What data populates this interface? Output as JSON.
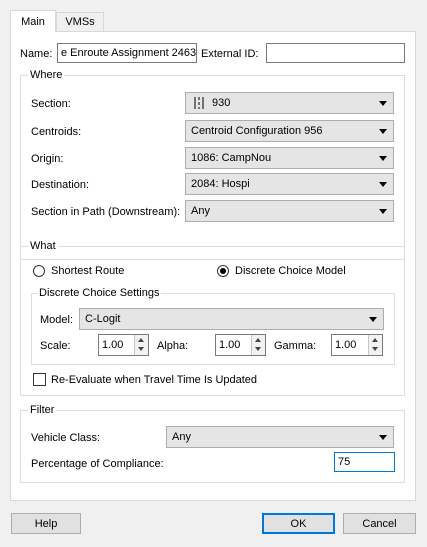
{
  "tabs": [
    {
      "label": "Main"
    },
    {
      "label": "VMSs"
    }
  ],
  "name": {
    "label": "Name:",
    "value": "e Enroute Assignment 2463"
  },
  "external_id": {
    "label": "External ID:",
    "value": ""
  },
  "where": {
    "title": "Where",
    "section": {
      "label": "Section:",
      "value": "930",
      "icon": "road-section-icon"
    },
    "centroids": {
      "label": "Centroids:",
      "value": "Centroid Configuration 956"
    },
    "origin": {
      "label": "Origin:",
      "value": "1086: CampNou"
    },
    "destination": {
      "label": "Destination:",
      "value": "2084: Hospi"
    },
    "section_in_path": {
      "label": "Section in Path (Downstream):",
      "value": "Any"
    }
  },
  "what": {
    "title": "What",
    "shortest_route": {
      "label": "Shortest Route",
      "selected": false
    },
    "discrete_choice": {
      "label": "Discrete Choice Model",
      "selected": true
    },
    "settings": {
      "title": "Discrete Choice Settings",
      "model": {
        "label": "Model:",
        "value": "C-Logit"
      },
      "scale": {
        "label": "Scale:",
        "value": "1.00"
      },
      "alpha": {
        "label": "Alpha:",
        "value": "1.00"
      },
      "gamma": {
        "label": "Gamma:",
        "value": "1.00"
      }
    },
    "reevaluate": {
      "label": "Re-Evaluate when Travel Time Is Updated",
      "checked": false
    }
  },
  "filter": {
    "title": "Filter",
    "vehicle_class": {
      "label": "Vehicle Class:",
      "value": "Any"
    },
    "compliance": {
      "label": "Percentage of Compliance:",
      "value": "75"
    }
  },
  "buttons": {
    "help": "Help",
    "ok": "OK",
    "cancel": "Cancel"
  },
  "colors": {
    "focus_border": "#0078d7",
    "panel_bg": "#ffffff",
    "window_bg": "#f0f0f0"
  }
}
